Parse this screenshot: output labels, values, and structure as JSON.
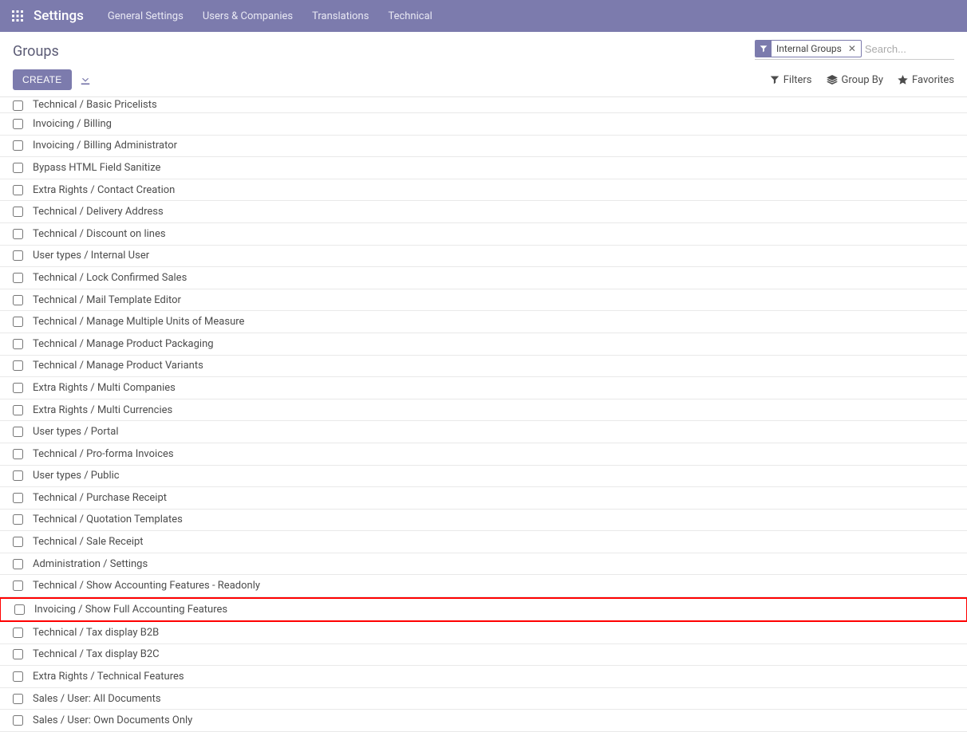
{
  "nav": {
    "brand": "Settings",
    "items": [
      "General Settings",
      "Users & Companies",
      "Translations",
      "Technical"
    ]
  },
  "breadcrumb": {
    "title": "Groups"
  },
  "search": {
    "facet_label": "Internal Groups",
    "placeholder": "Search..."
  },
  "buttons": {
    "create": "CREATE"
  },
  "tools": {
    "filters": "Filters",
    "group_by": "Group By",
    "favorites": "Favorites"
  },
  "rows": [
    {
      "label": "Technical / Basic Pricelists",
      "truncated_top": true
    },
    {
      "label": "Invoicing / Billing"
    },
    {
      "label": "Invoicing / Billing Administrator"
    },
    {
      "label": "Bypass HTML Field Sanitize"
    },
    {
      "label": "Extra Rights / Contact Creation"
    },
    {
      "label": "Technical / Delivery Address"
    },
    {
      "label": "Technical / Discount on lines"
    },
    {
      "label": "User types / Internal User"
    },
    {
      "label": "Technical / Lock Confirmed Sales"
    },
    {
      "label": "Technical / Mail Template Editor"
    },
    {
      "label": "Technical / Manage Multiple Units of Measure"
    },
    {
      "label": "Technical / Manage Product Packaging"
    },
    {
      "label": "Technical / Manage Product Variants"
    },
    {
      "label": "Extra Rights / Multi Companies"
    },
    {
      "label": "Extra Rights / Multi Currencies"
    },
    {
      "label": "User types / Portal"
    },
    {
      "label": "Technical / Pro-forma Invoices"
    },
    {
      "label": "User types / Public"
    },
    {
      "label": "Technical / Purchase Receipt"
    },
    {
      "label": "Technical / Quotation Templates"
    },
    {
      "label": "Technical / Sale Receipt"
    },
    {
      "label": "Administration / Settings"
    },
    {
      "label": "Technical / Show Accounting Features - Readonly"
    },
    {
      "label": "Invoicing / Show Full Accounting Features",
      "highlight": true
    },
    {
      "label": "Technical / Tax display B2B"
    },
    {
      "label": "Technical / Tax display B2C"
    },
    {
      "label": "Extra Rights / Technical Features"
    },
    {
      "label": "Sales / User: All Documents"
    },
    {
      "label": "Sales / User: Own Documents Only"
    }
  ]
}
